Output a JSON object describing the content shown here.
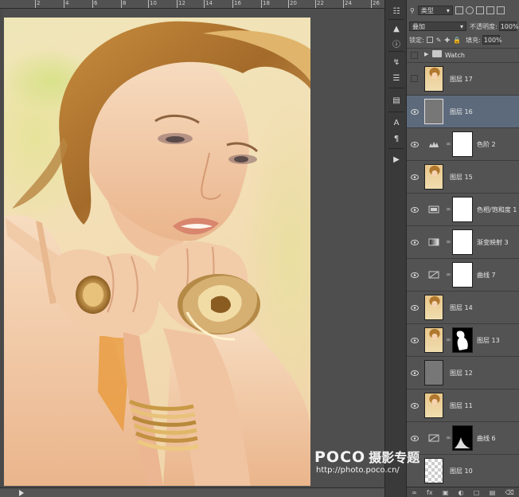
{
  "ruler": {
    "ticks": [
      "2",
      "4",
      "6",
      "8",
      "10",
      "12",
      "14",
      "16",
      "18",
      "20",
      "22",
      "24",
      "26"
    ]
  },
  "panel": {
    "filter_kind": "类型",
    "blend_mode": "叠加",
    "opacity_label": "不透明度:",
    "opacity_value": "100%",
    "lock_label": "锁定:",
    "fill_label": "填充:",
    "fill_value": "100%"
  },
  "layers": [
    {
      "name": "Watch",
      "kind": "group",
      "visible": false
    },
    {
      "name": "图层 17",
      "kind": "image",
      "visible": false
    },
    {
      "name": "图层 16",
      "kind": "gray",
      "visible": true,
      "selected": true
    },
    {
      "name": "色阶 2",
      "kind": "adjustment",
      "icon": "levels-icon",
      "mask": "white",
      "visible": true
    },
    {
      "name": "图层 15",
      "kind": "image",
      "visible": true
    },
    {
      "name": "色相/饱和度 1",
      "kind": "adjustment",
      "icon": "hue-saturation-icon",
      "mask": "white",
      "visible": true
    },
    {
      "name": "渐变映射 3",
      "kind": "adjustment",
      "icon": "gradient-map-icon",
      "mask": "white",
      "visible": true
    },
    {
      "name": "曲线 7",
      "kind": "adjustment",
      "icon": "curves-icon",
      "mask": "white",
      "visible": true
    },
    {
      "name": "图层 14",
      "kind": "image",
      "visible": true
    },
    {
      "name": "图层 13",
      "kind": "image",
      "mask": "silhouette",
      "visible": true
    },
    {
      "name": "图层 12",
      "kind": "gray",
      "visible": true
    },
    {
      "name": "图层 11",
      "kind": "image",
      "visible": true
    },
    {
      "name": "曲线 6",
      "kind": "adjustment",
      "icon": "curves-icon",
      "mask": "dark",
      "visible": true
    },
    {
      "name": "图层 10",
      "kind": "transparent",
      "visible": true
    }
  ],
  "watermark": {
    "logo": "POCO",
    "cn": "摄影专题",
    "url": "http://photo.poco.cn/"
  },
  "colors": {
    "panel_bg": "#535353",
    "selected": "#5d6a7c",
    "canvas_bg": "#4e4e4e"
  }
}
